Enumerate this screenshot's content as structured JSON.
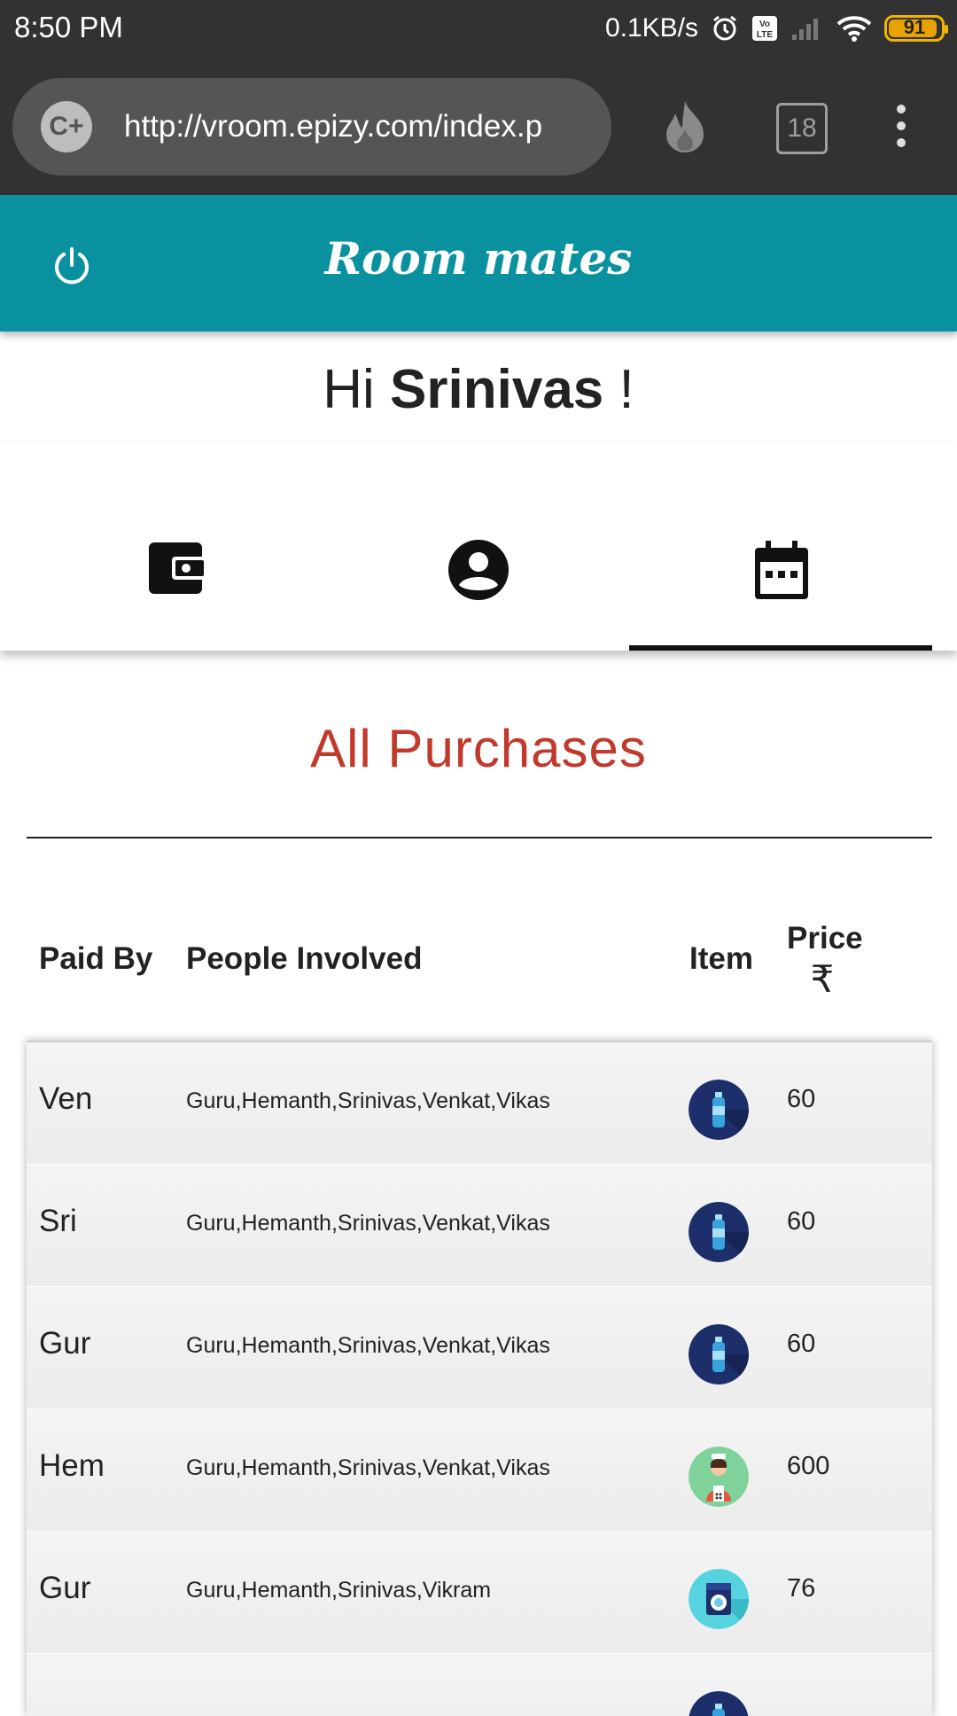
{
  "status": {
    "time": "8:50 PM",
    "net_speed": "0.1KB/s",
    "battery": "91"
  },
  "browser": {
    "url": "http://vroom.epizy.com/index.p",
    "site_icon": "C+",
    "tab_count": "18"
  },
  "app": {
    "title": "Room mates"
  },
  "greeting": {
    "prefix": "Hi",
    "name": "Srinivas",
    "suffix": "!"
  },
  "tabs": [
    {
      "icon": "wallet-icon",
      "active": false
    },
    {
      "icon": "account-circle-icon",
      "active": false
    },
    {
      "icon": "calendar-icon",
      "active": true
    }
  ],
  "section": {
    "title": "All Purchases"
  },
  "table": {
    "headers": {
      "paid_by": "Paid By",
      "people": "People Involved",
      "item": "Item",
      "price": "Price",
      "currency": "₹"
    },
    "rows": [
      {
        "paid_by": "Ven",
        "people": "Guru,Hemanth,Srinivas,Venkat,Vikas",
        "item_icon": "water-bottle-icon",
        "price": "60"
      },
      {
        "paid_by": "Sri",
        "people": "Guru,Hemanth,Srinivas,Venkat,Vikas",
        "item_icon": "water-bottle-icon",
        "price": "60"
      },
      {
        "paid_by": "Gur",
        "people": "Guru,Hemanth,Srinivas,Venkat,Vikas",
        "item_icon": "water-bottle-icon",
        "price": "60"
      },
      {
        "paid_by": "Hem",
        "people": "Guru,Hemanth,Srinivas,Venkat,Vikas",
        "item_icon": "maid-icon",
        "price": "600"
      },
      {
        "paid_by": "Gur",
        "people": "Guru,Hemanth,Srinivas,Vikram",
        "item_icon": "washing-machine-icon",
        "price": "76"
      }
    ]
  },
  "colors": {
    "header": "#0a919f",
    "section_title": "#c0392b",
    "status_bg": "#323232"
  }
}
